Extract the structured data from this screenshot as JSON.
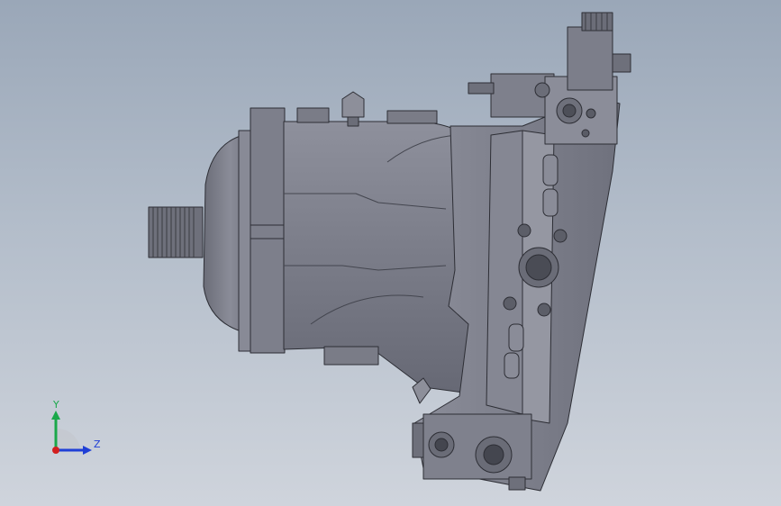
{
  "viewport": {
    "background_top": "#9aa7b8",
    "background_bottom": "#cfd4dc",
    "model_description_icon": "hydraulic-motor-3d-model",
    "part_colors": {
      "body": "#7d7f8c",
      "highlight": "#a9abb6",
      "shadow": "#5e606b",
      "edge": "#2d2e35"
    }
  },
  "triad": {
    "y_label": "Y",
    "z_label": "Z",
    "y_color": "#1aa84a",
    "z_color": "#1f3fd6",
    "origin_color": "#d21f1f"
  }
}
